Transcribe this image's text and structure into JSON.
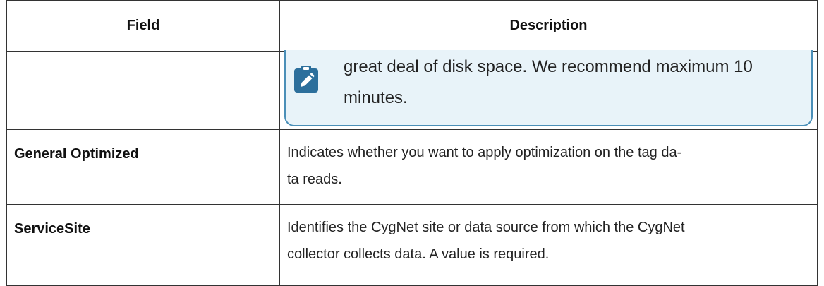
{
  "table": {
    "headers": {
      "field": "Field",
      "description": "Description"
    },
    "note_row": {
      "note": {
        "icon": "note-clipboard-pencil-icon",
        "line1": "great deal of disk space. We recommend maximum 10",
        "line2": "minutes."
      },
      "note_color": "#e8f3f9",
      "note_border_color": "#4a8fb8",
      "icon_color": "#2c6f9c"
    },
    "rows": [
      {
        "field": "General Optimized",
        "desc_line1": "Indicates whether you want to apply optimization on the tag da-",
        "desc_line2": "ta reads."
      },
      {
        "field": "ServiceSite",
        "desc_line1": "Identifies the CygNet site or data source from which the CygNet",
        "desc_line2": "collector collects data. A value is required."
      }
    ]
  }
}
